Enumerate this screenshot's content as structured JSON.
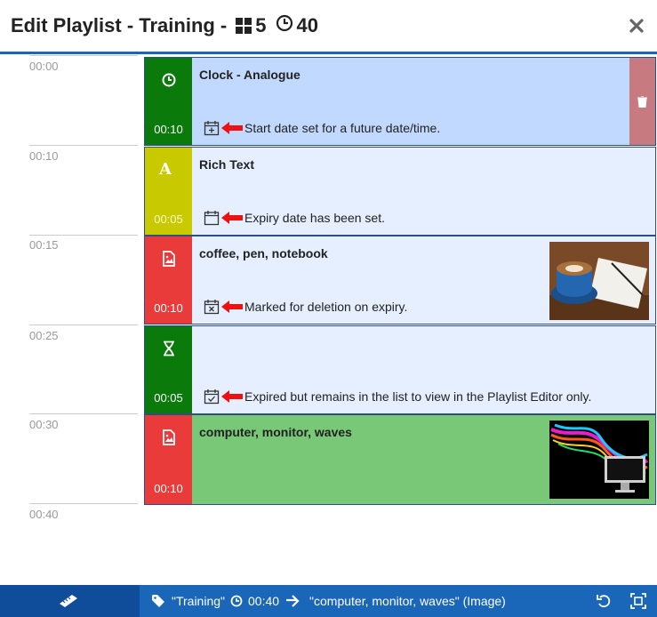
{
  "header": {
    "title": "Edit Playlist - Training -",
    "item_count": "5",
    "total_duration": "40"
  },
  "timeline": {
    "marks": [
      "00:00",
      "00:10",
      "00:15",
      "00:25",
      "00:30",
      "00:40"
    ]
  },
  "items": [
    {
      "name": "Clock - Analogue",
      "duration": "00:10",
      "note": "Start date set for a future date/time.",
      "type_icon": "clock-icon",
      "side_color": "#0a7a0a",
      "bg_color": "#c2d9ff"
    },
    {
      "name": "Rich Text",
      "duration": "00:05",
      "note": "Expiry date has been set.",
      "type_icon": "text-icon",
      "side_color": "#c9c900",
      "bg_color": "#e5efff"
    },
    {
      "name": "coffee, pen, notebook",
      "duration": "00:10",
      "note": "Marked for deletion on expiry.",
      "type_icon": "image-icon",
      "side_color": "#ea3b3b",
      "bg_color": "#e5efff"
    },
    {
      "name": "",
      "duration": "00:05",
      "note": "Expired but remains in the list to view in the Playlist Editor only.",
      "type_icon": "hourglass-icon",
      "side_color": "#0a7a0a",
      "bg_color": "#e5efff"
    },
    {
      "name": "computer, monitor, waves",
      "duration": "00:10",
      "note": "",
      "type_icon": "image-icon",
      "side_color": "#ea3b3b",
      "bg_color": "#78c878"
    }
  ],
  "footer": {
    "playlist": "\"Training\"",
    "duration": "00:40",
    "current": "\"computer, monitor, waves\" (Image)"
  }
}
